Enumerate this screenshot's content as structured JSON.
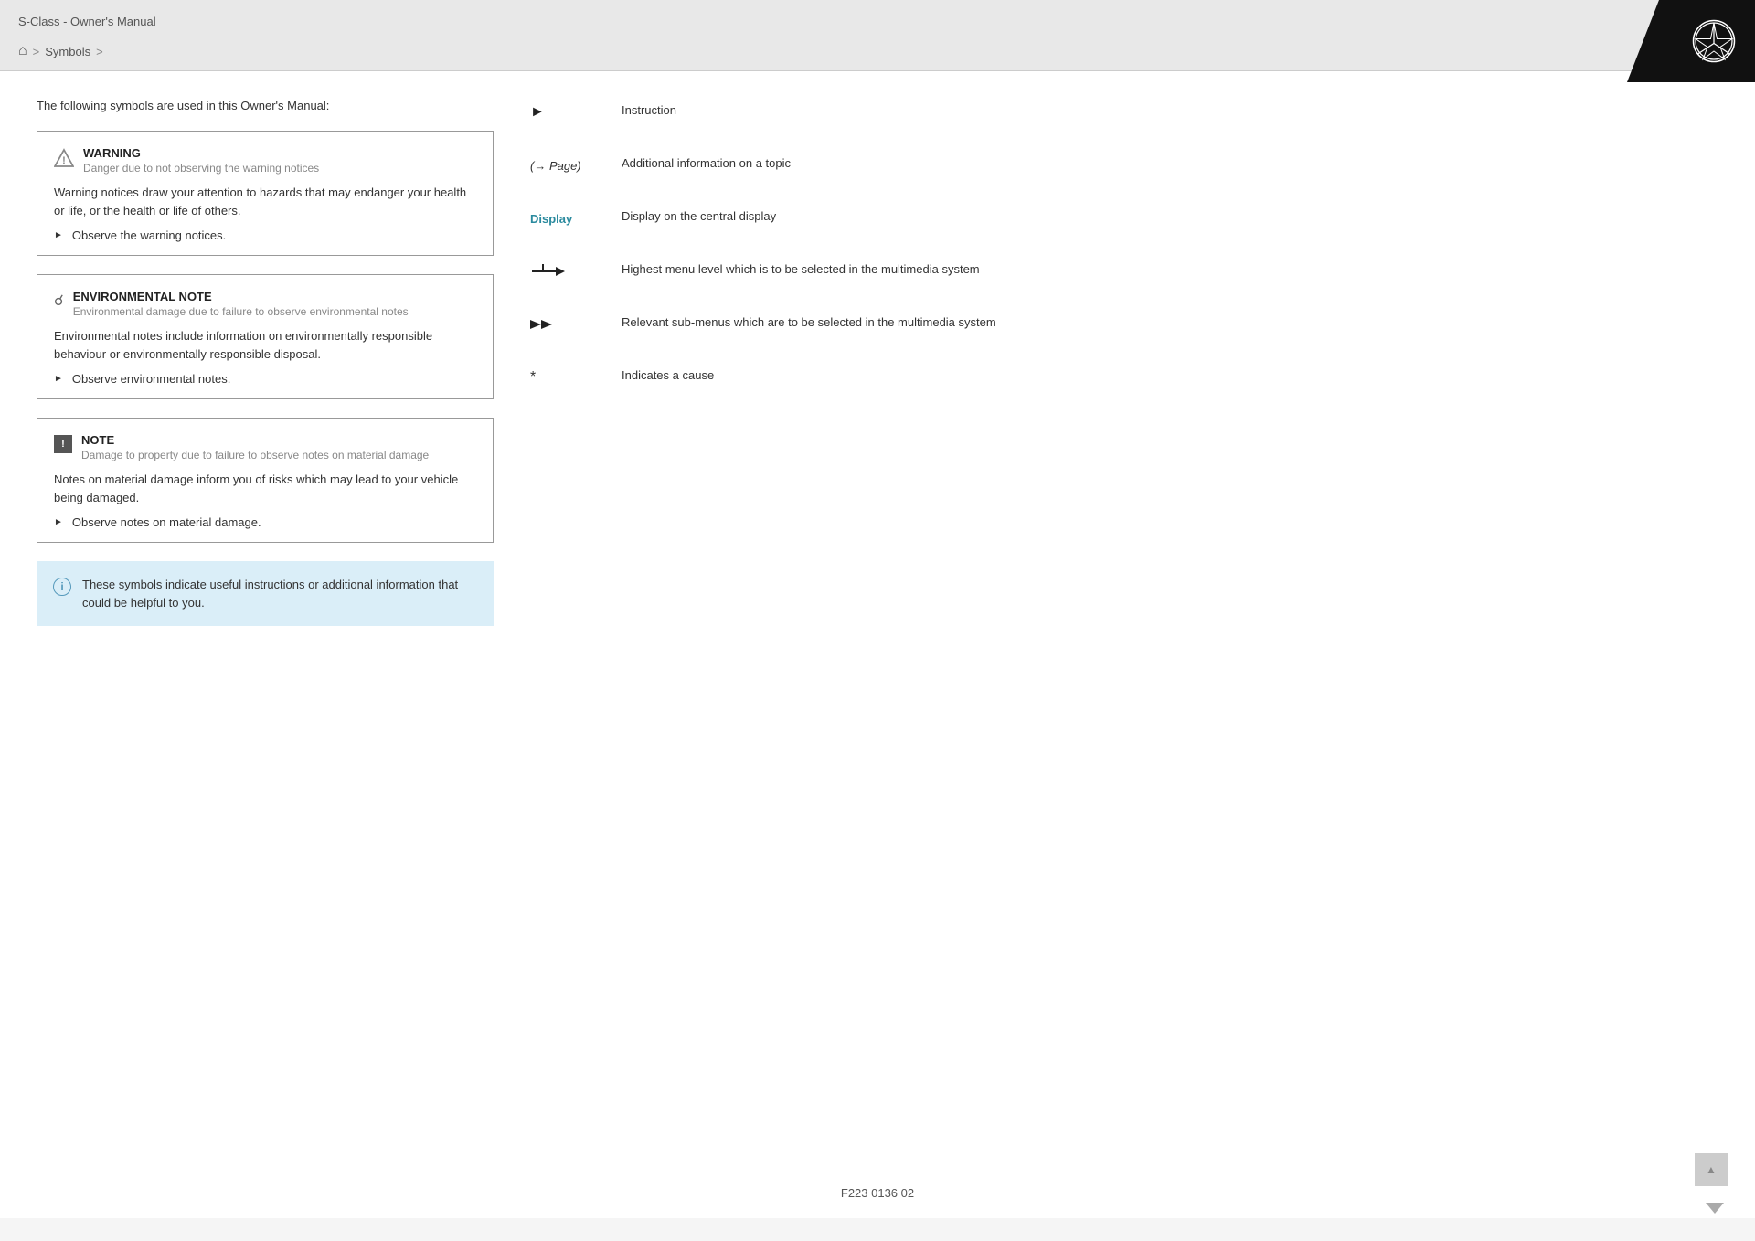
{
  "header": {
    "title": "S-Class - Owner's Manual",
    "breadcrumb": {
      "home_icon": "⌂",
      "sep1": ">",
      "item1": "Symbols",
      "sep2": ">"
    }
  },
  "main": {
    "intro": "The following symbols are used in this Owner's Manual:",
    "notices": [
      {
        "id": "warning",
        "title": "WARNING",
        "subtitle": "Danger due to not observing the warning notices",
        "body": "Warning notices draw your attention to hazards that may endanger your health or life, or the health or life of others.",
        "instruction": "Observe the warning notices."
      },
      {
        "id": "environmental",
        "title": "ENVIRONMENTAL NOTE",
        "subtitle": "Environmental damage due to failure to observe environmental notes",
        "body": "Environmental notes include information on environmentally responsible behaviour or environmentally responsible disposal.",
        "instruction": "Observe environmental notes."
      },
      {
        "id": "note",
        "title": "NOTE",
        "subtitle": "Damage to property due to failure to observe notes on material damage",
        "body": "Notes on material damage inform you of risks which may lead to your vehicle being damaged.",
        "instruction": "Observe notes on material damage."
      }
    ],
    "info_box": "These symbols indicate useful instructions or additional information that could be helpful to you.",
    "symbols": [
      {
        "id": "instruction",
        "icon_type": "arrow_right",
        "description": "Instruction"
      },
      {
        "id": "page_ref",
        "icon_type": "page_ref",
        "icon_text": "(→ Page)",
        "description": "Additional information on a topic"
      },
      {
        "id": "display",
        "icon_type": "display",
        "icon_text": "Display",
        "description": "Display on the central display"
      },
      {
        "id": "menu_top",
        "icon_type": "menu_arrow",
        "description": "Highest menu level which is to be selected in the multimedia system"
      },
      {
        "id": "submenu",
        "icon_type": "double_arrow",
        "description": "Relevant sub-menus which are to be selected in the multimedia system"
      },
      {
        "id": "cause",
        "icon_type": "asterisk",
        "description": "Indicates a cause"
      }
    ]
  },
  "footer": {
    "code": "F223 0136 02"
  }
}
